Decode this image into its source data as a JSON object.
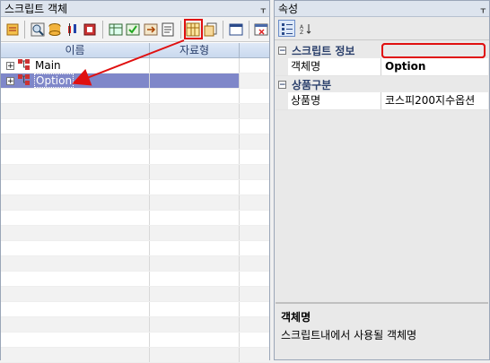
{
  "left_panel": {
    "title": "스크립트 객체",
    "pin_glyph": "ᚁ",
    "columns": [
      "이름",
      "자료형"
    ],
    "tree": [
      {
        "label": "Main",
        "expander": "+",
        "selected": false
      },
      {
        "label": "Option",
        "expander": "+",
        "selected": true
      }
    ]
  },
  "right_panel": {
    "title": "속성",
    "pin_glyph": "ᚁ",
    "categories": [
      {
        "label": "스크립트 정보",
        "expander": "−",
        "props": [
          {
            "name": "객체명",
            "value": "Option"
          }
        ]
      },
      {
        "label": "상품구분",
        "expander": "−",
        "props": [
          {
            "name": "상품명",
            "value": "코스피200지수옵션"
          }
        ]
      }
    ],
    "description": {
      "title": "객체명",
      "text": "스크립트내에서 사용될 객체명"
    }
  },
  "colors": {
    "accent_red": "#e01010",
    "selection": "#7f87c9"
  }
}
